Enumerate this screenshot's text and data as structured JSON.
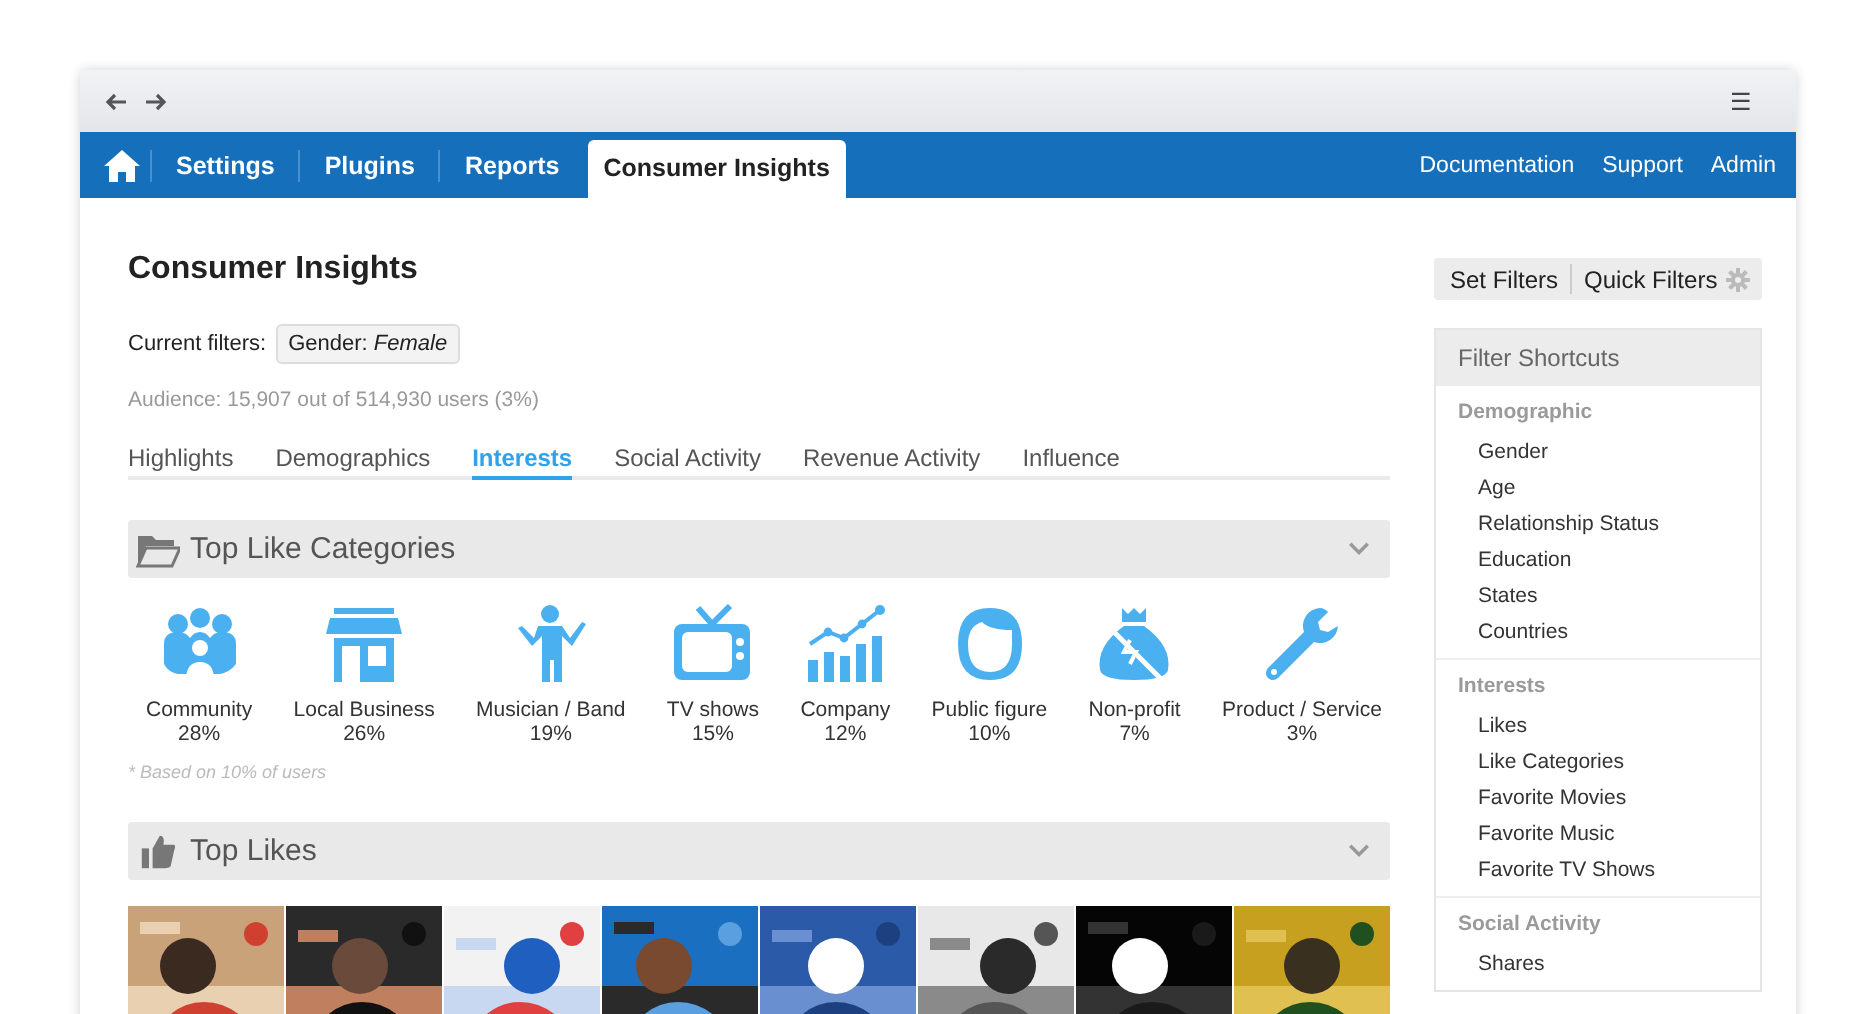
{
  "browser": {
    "menu_glyph": "☰"
  },
  "nav": {
    "left": [
      {
        "label": "Settings",
        "selected": false
      },
      {
        "label": "Plugins",
        "selected": false
      },
      {
        "label": "Reports",
        "selected": false
      },
      {
        "label": "Consumer Insights",
        "selected": true
      }
    ],
    "right": [
      "Documentation",
      "Support",
      "Admin"
    ]
  },
  "page": {
    "title": "Consumer Insights",
    "filters_label": "Current filters:",
    "filter_chip": "Gender: *Female*",
    "audience": "Audience: 15,907 out of 514,930 users (3%)"
  },
  "tabs": [
    {
      "label": "Highlights",
      "selected": false
    },
    {
      "label": "Demographics",
      "selected": false
    },
    {
      "label": "Interests",
      "selected": true
    },
    {
      "label": "Social Activity",
      "selected": false
    },
    {
      "label": "Revenue Activity",
      "selected": false
    },
    {
      "label": "Influence",
      "selected": false
    }
  ],
  "like_categories": {
    "title": "Top Like Categories",
    "expanded": true,
    "note": "* Based on 10% of users",
    "items": [
      {
        "label": "Community",
        "share": "28%"
      },
      {
        "label": "Local Business",
        "share": "26%"
      },
      {
        "label": "Musician / Band",
        "share": "19%"
      },
      {
        "label": "TV shows",
        "share": "15%"
      },
      {
        "label": "Company",
        "share": "12%"
      },
      {
        "label": "Public figure",
        "share": "10%"
      },
      {
        "label": "Non-profit",
        "share": "7%"
      },
      {
        "label": "Product / Service",
        "share": "3%"
      }
    ]
  },
  "top_likes": {
    "title": "Top Likes",
    "expanded": true
  },
  "sidebar": {
    "buttons": [
      "Set Filters",
      "Quick Filters"
    ],
    "title": "Filter Shortcuts",
    "groups": [
      {
        "label": "Demographic",
        "items": [
          "Gender",
          "Age",
          "Relationship Status",
          "Education",
          "States",
          "Countries"
        ]
      },
      {
        "label": "Interests",
        "items": [
          "Likes",
          "Like Categories",
          "Favorite Movies",
          "Favorite Music",
          "Favorite TV Shows"
        ]
      },
      {
        "label": "Social Activity",
        "items": [
          "Shares"
        ]
      }
    ]
  }
}
